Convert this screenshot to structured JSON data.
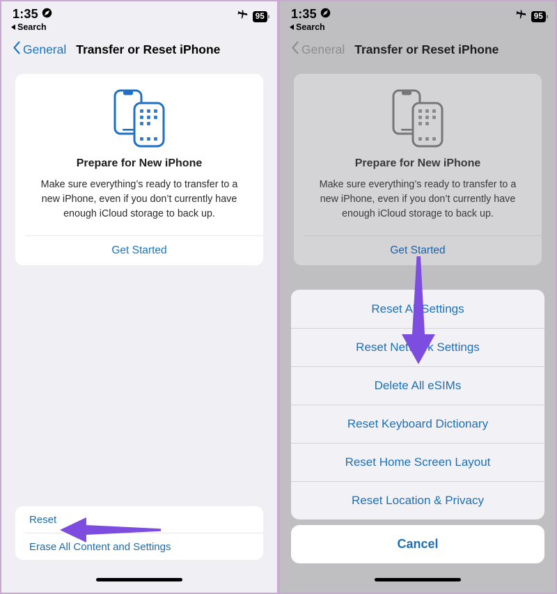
{
  "meta": {
    "accent_blue": "#1675c4",
    "annotation_purple": "#7c4dde",
    "frame_border": "#c9a8d4",
    "left_bg": "#f0eff4",
    "right_bg": "#bfbfc2",
    "sheet_bg": "#f2f1f6"
  },
  "status_bar": {
    "time": "1:35",
    "location_icon": "location-arrow-icon",
    "back_to_app_label": "Search",
    "airplane_icon": "airplane-mode-icon",
    "battery_percent": "95"
  },
  "nav": {
    "back_label": "General",
    "title": "Transfer or Reset iPhone",
    "back_icon": "chevron-left-icon"
  },
  "prepare_card": {
    "illustration": "two-iphones-icon",
    "title": "Prepare for New iPhone",
    "description": "Make sure everything’s ready to transfer to a new iPhone, even if you don’t currently have enough iCloud storage to back up.",
    "action_label": "Get Started"
  },
  "reset_card": {
    "rows": [
      {
        "label": "Reset"
      },
      {
        "label": "Erase All Content and Settings"
      }
    ]
  },
  "action_sheet": {
    "options": [
      {
        "label": "Reset All Settings"
      },
      {
        "label": "Reset Network Settings"
      },
      {
        "label": "Delete All eSIMs"
      },
      {
        "label": "Reset Keyboard Dictionary"
      },
      {
        "label": "Reset Home Screen Layout"
      },
      {
        "label": "Reset Location & Privacy"
      }
    ],
    "occluded_label": "Reset",
    "cancel_label": "Cancel"
  },
  "annotations": {
    "left_arrow": {
      "icon": "arrow-left-annotation",
      "points_at": "Reset"
    },
    "right_arrow": {
      "icon": "arrow-down-annotation",
      "points_at": "Reset Network Settings"
    }
  }
}
